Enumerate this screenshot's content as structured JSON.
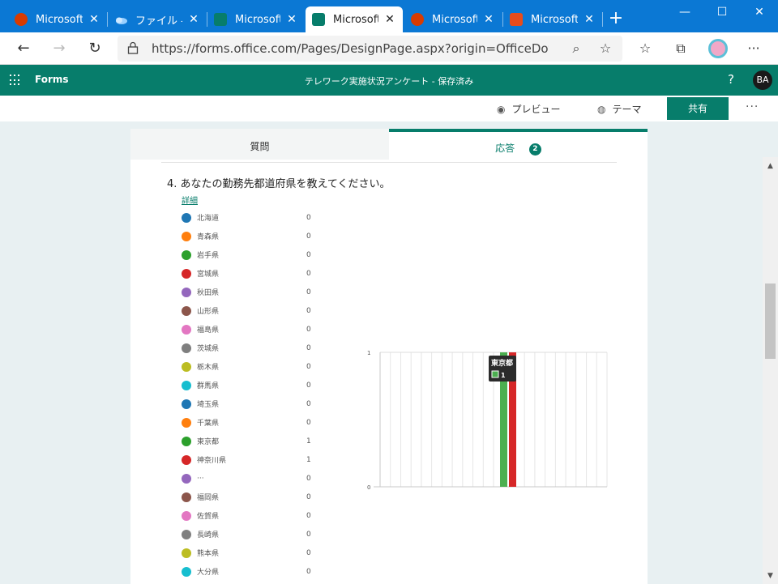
{
  "browser": {
    "tabs": [
      {
        "label": "Microsoft",
        "icon": "office-icon"
      },
      {
        "label": "ファイル - O",
        "icon": "onedrive-icon"
      },
      {
        "label": "Microsoft",
        "icon": "forms-icon"
      },
      {
        "label": "Microsoft",
        "icon": "forms-icon",
        "active": true
      },
      {
        "label": "Microsoft",
        "icon": "office-icon"
      },
      {
        "label": "Microsoft",
        "icon": "office-red-icon"
      }
    ],
    "new_tab": "+",
    "url": "https://forms.office.com/Pages/DesignPage.aspx?origin=OfficeDotC..."
  },
  "app": {
    "brand": "Forms",
    "doc_title": "テレワーク実施状況アンケート - 保存済み",
    "help": "?",
    "avatar": "BA"
  },
  "commands": {
    "preview": "プレビュー",
    "theme": "テーマ",
    "share": "共有",
    "more": "···"
  },
  "content_tabs": {
    "questions": "質問",
    "responses": "応答",
    "response_count": "2"
  },
  "question": {
    "title": "4.  あなたの勤務先都道府県を教えてください。",
    "details_link": "詳細"
  },
  "legend": [
    {
      "name": "北海道",
      "value": "0",
      "color": "#1f77b4"
    },
    {
      "name": "青森県",
      "value": "0",
      "color": "#ff7f0e"
    },
    {
      "name": "岩手県",
      "value": "0",
      "color": "#2ca02c"
    },
    {
      "name": "宮城県",
      "value": "0",
      "color": "#d62728"
    },
    {
      "name": "秋田県",
      "value": "0",
      "color": "#9467bd"
    },
    {
      "name": "山形県",
      "value": "0",
      "color": "#8c564b"
    },
    {
      "name": "福島県",
      "value": "0",
      "color": "#e377c2"
    },
    {
      "name": "茨城県",
      "value": "0",
      "color": "#7f7f7f"
    },
    {
      "name": "栃木県",
      "value": "0",
      "color": "#bcbd22"
    },
    {
      "name": "群馬県",
      "value": "0",
      "color": "#17becf"
    },
    {
      "name": "埼玉県",
      "value": "0",
      "color": "#1f77b4"
    },
    {
      "name": "千葉県",
      "value": "0",
      "color": "#ff7f0e"
    },
    {
      "name": "東京都",
      "value": "1",
      "color": "#2ca02c"
    },
    {
      "name": "神奈川県",
      "value": "1",
      "color": "#d62728"
    },
    {
      "name": "···",
      "value": "0",
      "color": "#9467bd"
    },
    {
      "name": "福岡県",
      "value": "0",
      "color": "#8c564b"
    },
    {
      "name": "佐賀県",
      "value": "0",
      "color": "#e377c2"
    },
    {
      "name": "長崎県",
      "value": "0",
      "color": "#7f7f7f"
    },
    {
      "name": "熊本県",
      "value": "0",
      "color": "#bcbd22"
    },
    {
      "name": "大分県",
      "value": "0",
      "color": "#17becf"
    }
  ],
  "chart_data": {
    "type": "bar",
    "ylim": [
      0,
      1
    ],
    "yticks": [
      "1",
      "0"
    ],
    "gridlines": 22,
    "bars": [
      {
        "name": "東京都",
        "value": 1,
        "color": "#4caf50"
      },
      {
        "name": "神奈川県",
        "value": 1,
        "color": "#d62728"
      }
    ],
    "tooltip": {
      "name": "東京都",
      "value": "1",
      "color": "#4caf50"
    }
  }
}
